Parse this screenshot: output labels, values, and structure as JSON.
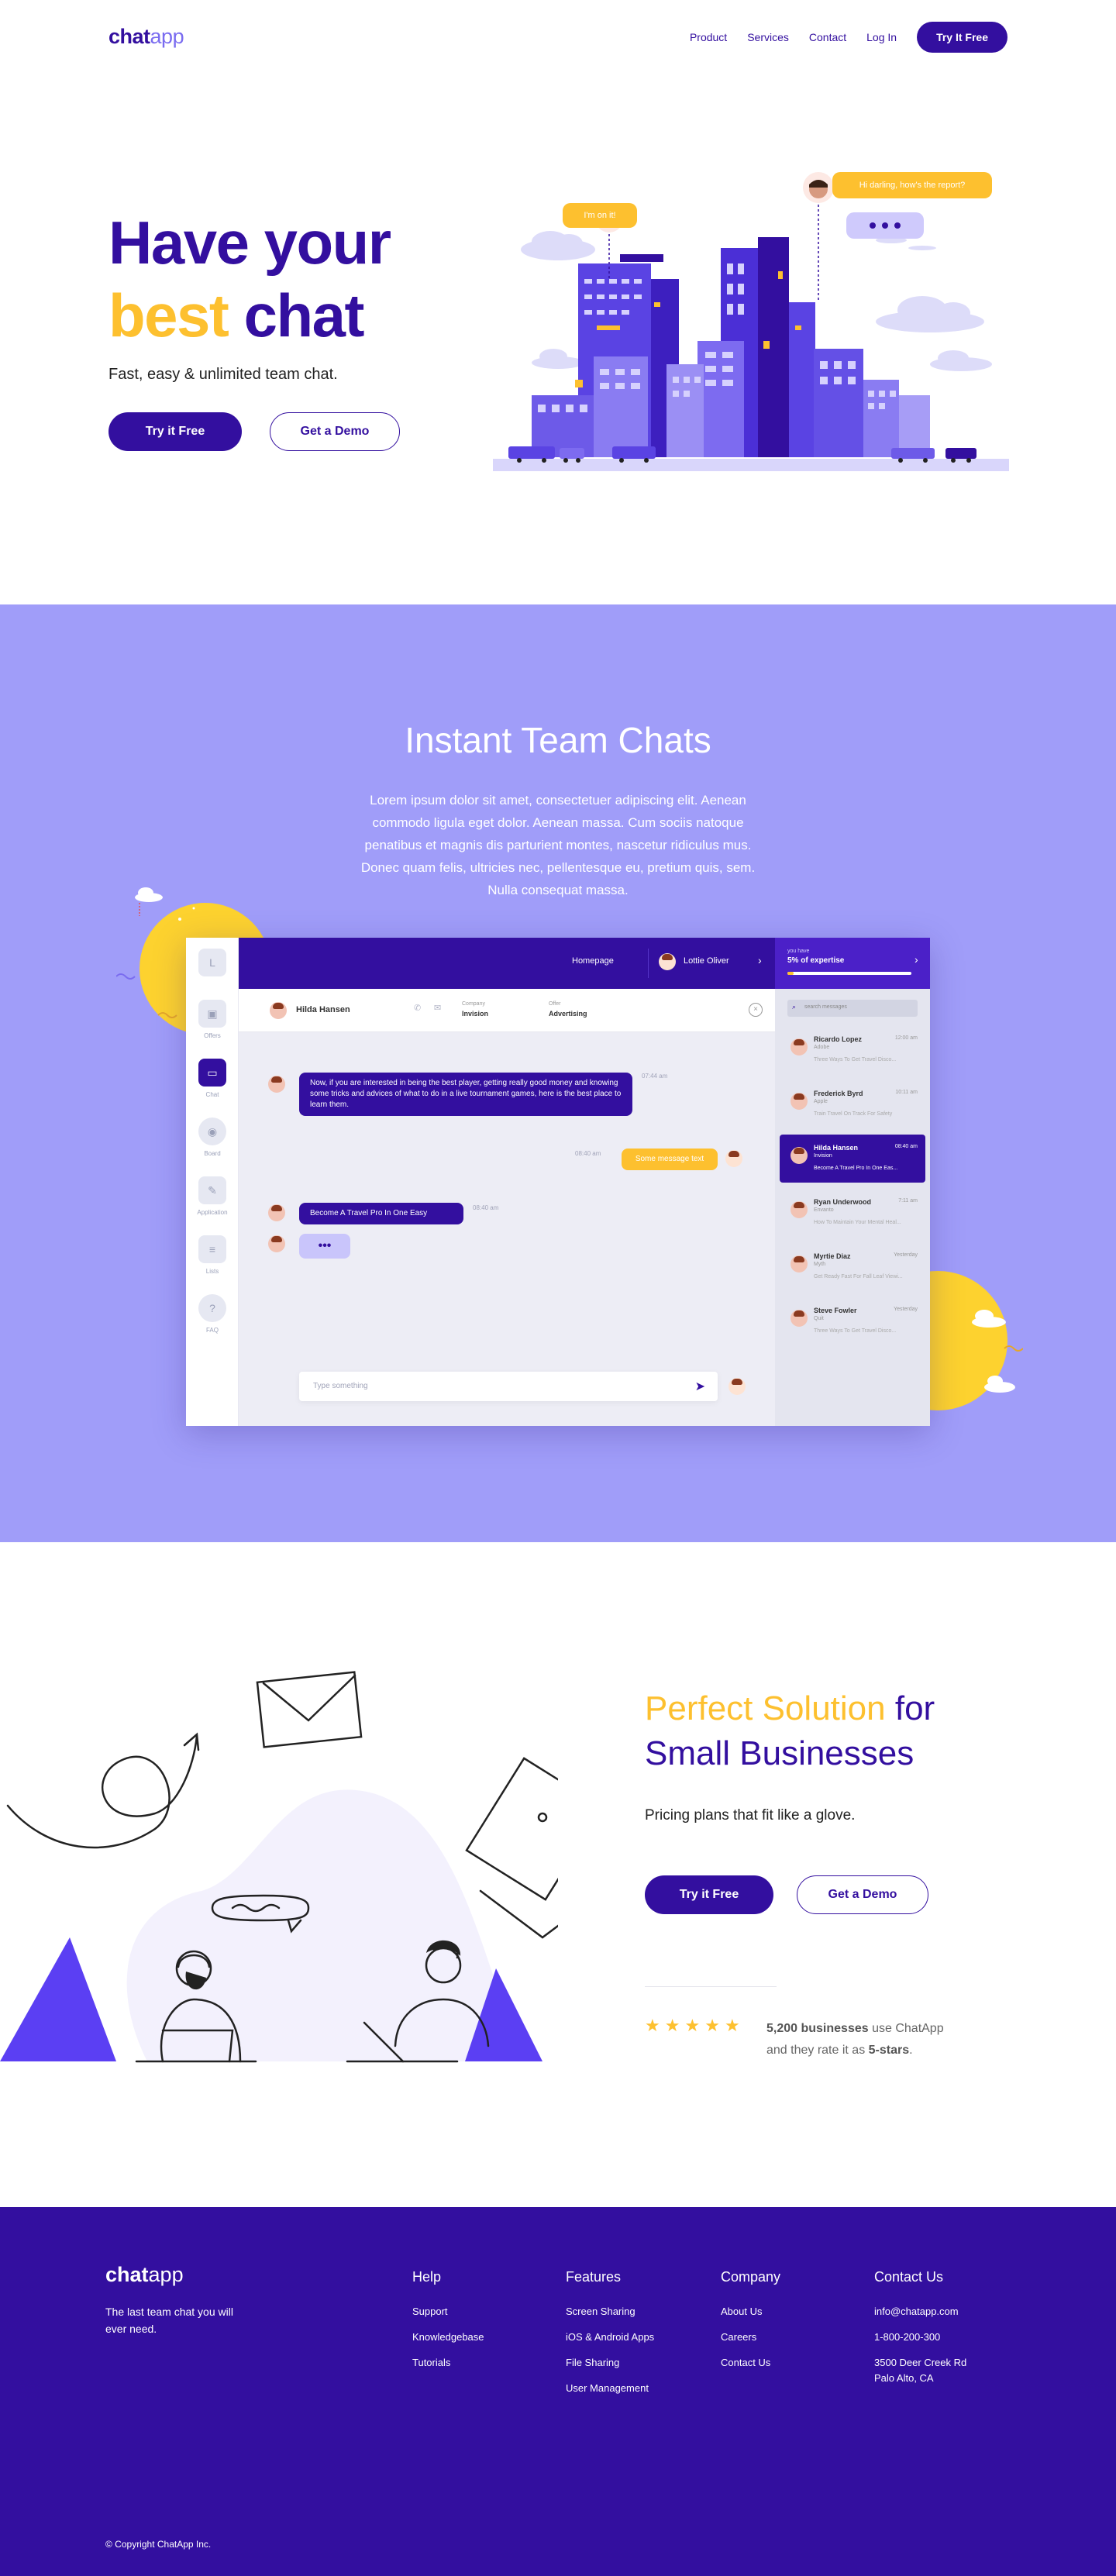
{
  "nav": {
    "logo_bold": "chat",
    "logo_light": "app",
    "links": [
      "Product",
      "Services",
      "Contact",
      "Log In"
    ],
    "cta": "Try It Free"
  },
  "hero": {
    "title_line1": "Have your",
    "title_best": "best",
    "title_chat": "chat",
    "subtitle": "Fast, easy & unlimited team chat.",
    "primary_btn": "Try it Free",
    "secondary_btn": "Get a Demo",
    "illustration": {
      "bubble_left": "I'm on it!",
      "bubble_right": "Hi darling, how's the report?"
    }
  },
  "team_chats": {
    "title": "Instant Team Chats",
    "body": "Lorem ipsum dolor sit amet, consectetuer adipiscing elit. Aenean commodo ligula eget dolor. Aenean massa. Cum sociis natoque penatibus et magnis dis parturient montes, nascetur ridiculus mus. Donec quam felis, ultricies nec, pellentesque eu, pretium quis, sem. Nulla consequat massa."
  },
  "app": {
    "sidebar": [
      {
        "label": "",
        "icon": "logo-icon"
      },
      {
        "label": "Offers",
        "icon": "briefcase-icon"
      },
      {
        "label": "Chat",
        "icon": "chat-icon"
      },
      {
        "label": "Board",
        "icon": "board-icon"
      },
      {
        "label": "Application",
        "icon": "application-icon"
      },
      {
        "label": "Lists",
        "icon": "list-icon"
      },
      {
        "label": "FAQ",
        "icon": "help-icon"
      }
    ],
    "topbar": {
      "homepage": "Homepage",
      "user": "Lottie Oliver",
      "progress_label": "you have",
      "progress_value": "5% of expertise",
      "progress_fraction": 0.05
    },
    "chat_header": {
      "name": "Hilda Hansen",
      "company_label": "Company",
      "company": "Invision",
      "offer_label": "Offer",
      "offer": "Advertising"
    },
    "messages": {
      "m1": "Now, if you are interested in being the best player, getting really good money and knowing some tricks and advices of what to do in a live tournament games, here is the best place to learn them.",
      "m1_time": "07:44 am",
      "m2": "Some message text",
      "m2_time": "08:40 am",
      "m3": "Become A Travel Pro In One Easy",
      "m3_time": "08:40 am",
      "typing": "•••",
      "input_placeholder": "Type something"
    },
    "search_placeholder": "search messages",
    "contacts": [
      {
        "name": "Ricardo Lopez",
        "company": "Adobe",
        "msg": "Three Ways To Get Travel Disco...",
        "time": "12:00 am"
      },
      {
        "name": "Frederick Byrd",
        "company": "Apple",
        "msg": "Train Travel On Track For Safety",
        "time": "10:11 am"
      },
      {
        "name": "Hilda Hansen",
        "company": "Invision",
        "msg": "Become A Travel Pro In One Eas...",
        "time": "08:40 am"
      },
      {
        "name": "Ryan Underwood",
        "company": "Envanto",
        "msg": "How To Maintain Your Mental Heal...",
        "time": "7:11 am"
      },
      {
        "name": "Myrtie Diaz",
        "company": "Myth",
        "msg": "Get Ready Fast For Fall Leaf Viewi...",
        "time": "Yesterday"
      },
      {
        "name": "Steve Fowler",
        "company": "Quit",
        "msg": "Three Ways To Get Travel Disco...",
        "time": "Yesterday"
      }
    ]
  },
  "solution": {
    "title_yellow": "Perfect Solution",
    "title_for": "for",
    "title_line2": "Small Businesses",
    "subtitle": "Pricing plans that fit like a glove.",
    "primary_btn": "Try it Free",
    "secondary_btn": "Get a Demo",
    "rating_count": "5,200 businesses",
    "rating_text1": "use ChatApp",
    "rating_text2": "and they rate it as",
    "rating_stars_text": "5-stars",
    "stars": 5
  },
  "footer": {
    "logo_bold": "chat",
    "logo_light": "app",
    "tagline": "The last team chat you will ever need.",
    "help": {
      "title": "Help",
      "items": [
        "Support",
        "Knowledgebase",
        "Tutorials"
      ]
    },
    "features": {
      "title": "Features",
      "items": [
        "Screen Sharing",
        "iOS & Android Apps",
        "File Sharing",
        "User Management"
      ]
    },
    "company": {
      "title": "Company",
      "items": [
        "About Us",
        "Careers",
        "Contact Us"
      ]
    },
    "contact": {
      "title": "Contact Us",
      "items": [
        "info@chatapp.com",
        "1-800-200-300",
        "3500 Deer Creek Rd",
        "Palo Alto, CA"
      ]
    },
    "copyright": "© Copyright ChatApp Inc."
  },
  "colors": {
    "brand": "#330f9f",
    "accent_yellow": "#fdc02f",
    "lavender": "#a09df9"
  }
}
